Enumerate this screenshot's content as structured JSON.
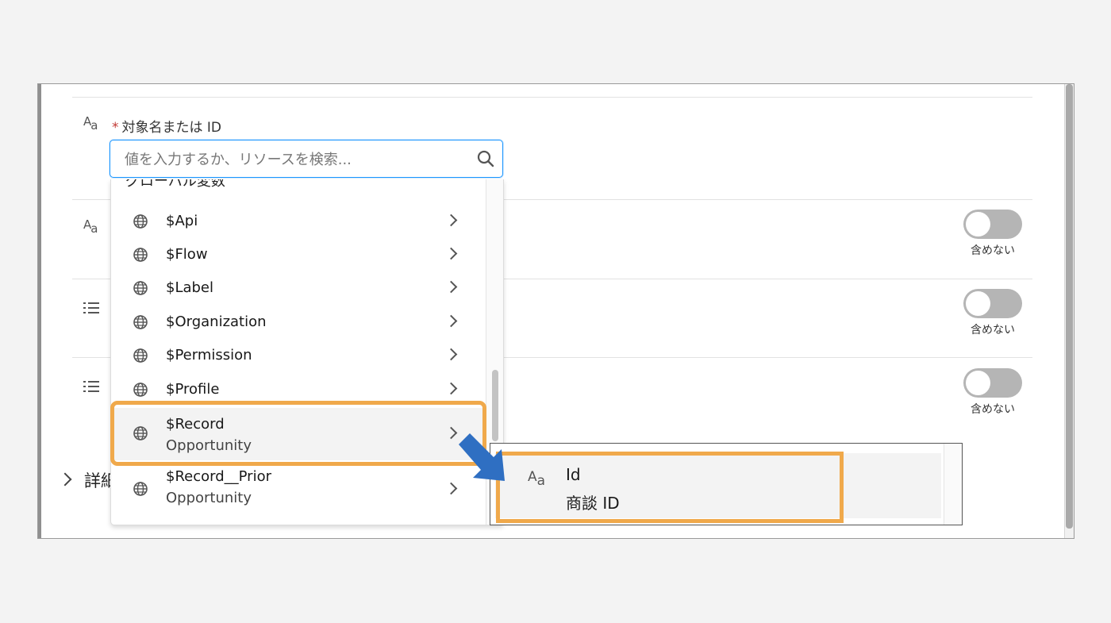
{
  "field": {
    "required_mark": "*",
    "label": "対象名または ID",
    "search_placeholder": "値を入力するか、リソースを検索..."
  },
  "dropdown": {
    "header": "グローバル変数",
    "items": [
      {
        "name": "$Api",
        "sub": ""
      },
      {
        "name": "$Flow",
        "sub": ""
      },
      {
        "name": "$Label",
        "sub": ""
      },
      {
        "name": "$Organization",
        "sub": ""
      },
      {
        "name": "$Permission",
        "sub": ""
      },
      {
        "name": "$Profile",
        "sub": ""
      },
      {
        "name": "$Record",
        "sub": "Opportunity"
      },
      {
        "name": "$Record__Prior",
        "sub": "Opportunity"
      }
    ]
  },
  "toggles": [
    {
      "label": "含めない",
      "on": false
    },
    {
      "label": "含めない",
      "on": false
    },
    {
      "label": "含めない",
      "on": false
    }
  ],
  "details": {
    "label": "詳細"
  },
  "submenu": {
    "item_name": "Id",
    "item_desc": "商談 ID"
  },
  "colors": {
    "highlight": "#f0a94b",
    "arrow": "#2f6fc2",
    "focus_border": "#1b96ff"
  },
  "icons": {
    "text_type": "text-type-icon",
    "list": "list-icon",
    "globe": "globe-icon",
    "search": "search-icon",
    "chevron": "chevron-right-icon"
  }
}
